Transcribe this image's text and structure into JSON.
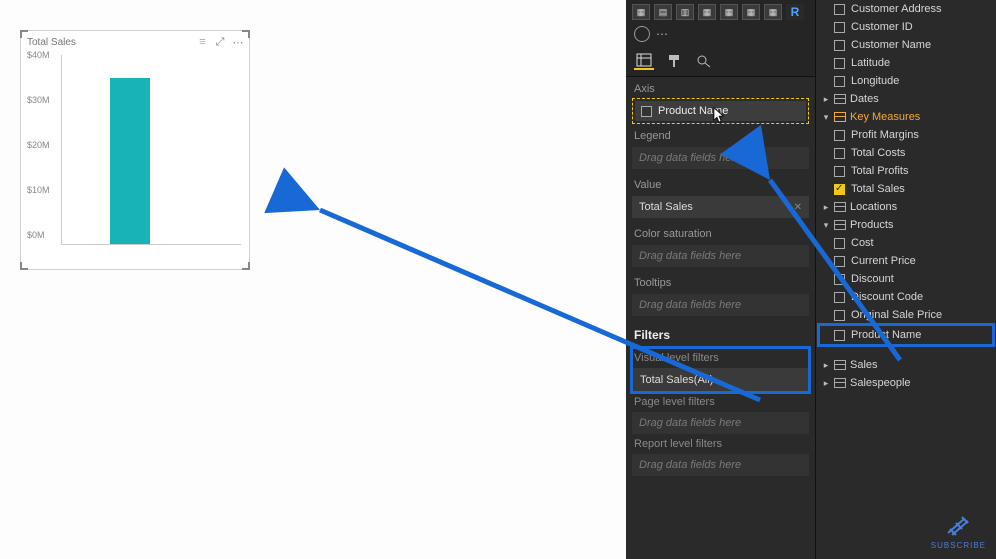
{
  "visual": {
    "title": "Total Sales",
    "chart_data": {
      "type": "bar",
      "categories": [
        ""
      ],
      "values": [
        35000000
      ],
      "ylabel": "",
      "ylim": [
        0,
        40000000
      ],
      "y_ticks": [
        "$0M",
        "$10M",
        "$20M",
        "$30M",
        "$40M"
      ],
      "bar_color": "#17b3b6"
    }
  },
  "vizPane": {
    "r_label": "R",
    "modeTabs": [
      "fields",
      "format",
      "analytics"
    ],
    "wells": {
      "axis": {
        "label": "Axis",
        "chip": "Product Name"
      },
      "legend": {
        "label": "Legend",
        "placeholder": "Drag data fields here"
      },
      "value": {
        "label": "Value",
        "chip": "Total Sales"
      },
      "colorSat": {
        "label": "Color saturation",
        "placeholder": "Drag data fields here"
      },
      "tooltips": {
        "label": "Tooltips",
        "placeholder": "Drag data fields here"
      }
    },
    "filters": {
      "header": "Filters",
      "visual": {
        "label": "Visual level filters",
        "chip": "Total Sales(All)"
      },
      "page": {
        "label": "Page level filters",
        "placeholder": "Drag data fields here"
      },
      "report": {
        "label": "Report level filters",
        "placeholder": "Drag data fields here"
      }
    }
  },
  "fieldsPane": {
    "topFields": [
      "Customer Address",
      "Customer ID",
      "Customer Name",
      "Latitude",
      "Longitude"
    ],
    "tables": {
      "dates": "Dates",
      "keyMeasures": {
        "name": "Key Measures",
        "fields": [
          "Profit Margins",
          "Total Costs",
          "Total Profits",
          "Total Sales"
        ],
        "checked": [
          "Total Sales"
        ]
      },
      "locations": "Locations",
      "products": {
        "name": "Products",
        "fields": [
          "Cost",
          "Current Price",
          "Discount",
          "Discount Code",
          "Original Sale Price"
        ],
        "highlighted": "Product Name"
      },
      "sales": "Sales",
      "salespeople": "Salespeople"
    }
  },
  "subscribe": "SUBSCRIBE",
  "chart_data": {
    "type": "bar",
    "categories": [
      ""
    ],
    "values": [
      35000000
    ],
    "title": "Total Sales",
    "ylim": [
      0,
      40000000
    ],
    "y_ticks": [
      0,
      10000000,
      20000000,
      30000000,
      40000000
    ]
  }
}
